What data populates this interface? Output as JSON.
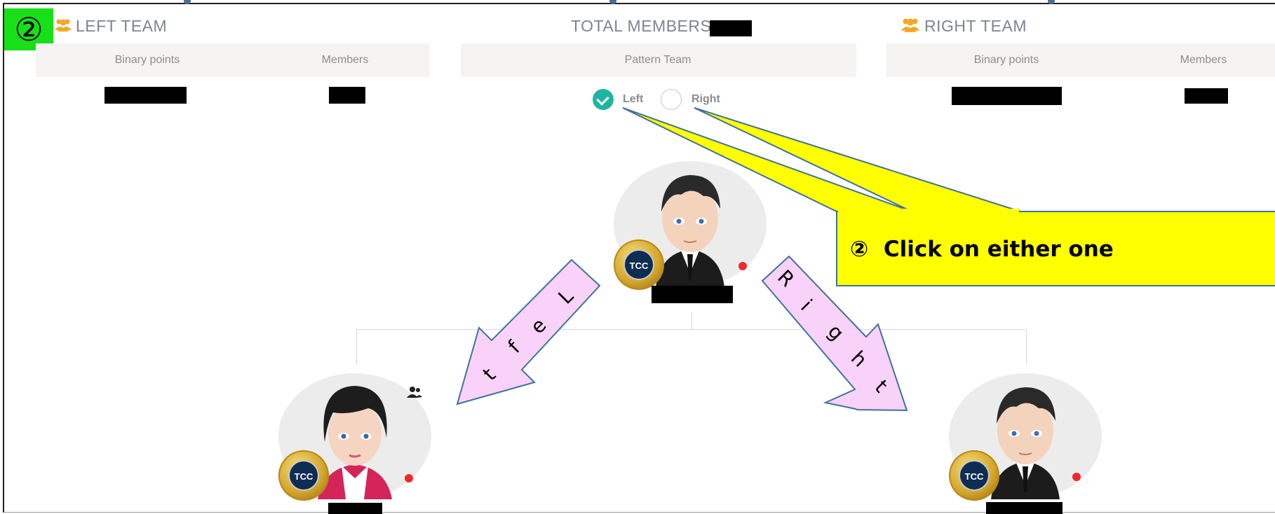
{
  "step_marker": "②",
  "left_team": {
    "title": "LEFT TEAM",
    "col_binary": "Binary points",
    "col_members": "Members"
  },
  "total": {
    "title": "TOTAL MEMBERS",
    "col_pattern": "Pattern Team"
  },
  "right_team": {
    "title": "RIGHT TEAM",
    "col_binary": "Binary points",
    "col_members": "Members"
  },
  "pattern": {
    "option_left": "Left",
    "option_right": "Right",
    "selected": "Left"
  },
  "callout": {
    "number": "②",
    "text": "Click on either one"
  },
  "arrows": {
    "left_letters": [
      "L",
      "e",
      "f",
      "t"
    ],
    "right_letters": [
      "R",
      "i",
      "g",
      "h",
      "t"
    ]
  },
  "coin_label": "TCC",
  "colors": {
    "badge_green": "#18e018",
    "callout_yellow": "#ffff00",
    "arrow_pink": "#f8d2f8",
    "radio_checked": "#1fb5a0",
    "status_dot": "#f02a2a",
    "team_icon": "#f5a623"
  },
  "icons": {
    "team": "users-icon",
    "add_member": "add-user-icon",
    "check": "check-icon"
  }
}
